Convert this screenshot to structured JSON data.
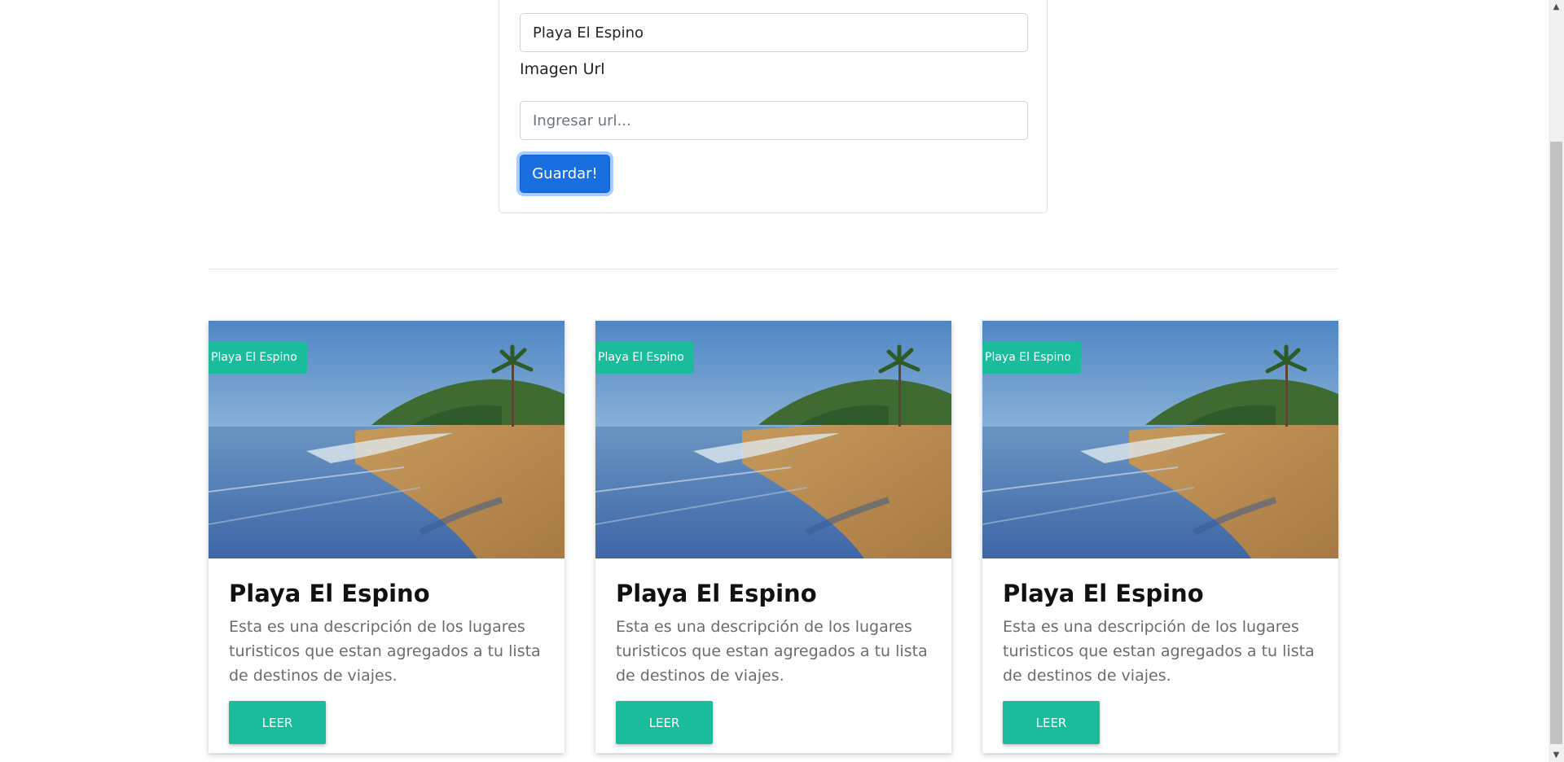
{
  "form": {
    "name_value": "Playa El Espino",
    "url_label": "Imagen Url",
    "url_placeholder": "Ingresar url...",
    "save_label": "Guardar!"
  },
  "cards": [
    {
      "tag": "Playa El Espino",
      "title": "Playa El Espino",
      "description": "Esta es una descripción de los lugares turisticos que estan agregados a tu lista de destinos de viajes.",
      "button": "LEER"
    },
    {
      "tag": "Playa El Espino",
      "title": "Playa El Espino",
      "description": "Esta es una descripción de los lugares turisticos que estan agregados a tu lista de destinos de viajes.",
      "button": "LEER"
    },
    {
      "tag": "Playa El Espino",
      "title": "Playa El Espino",
      "description": "Esta es una descripción de los lugares turisticos que estan agregados a tu lista de destinos de viajes.",
      "button": "LEER"
    }
  ],
  "colors": {
    "accent": "#1abc9c",
    "primary": "#1a6fe0"
  }
}
